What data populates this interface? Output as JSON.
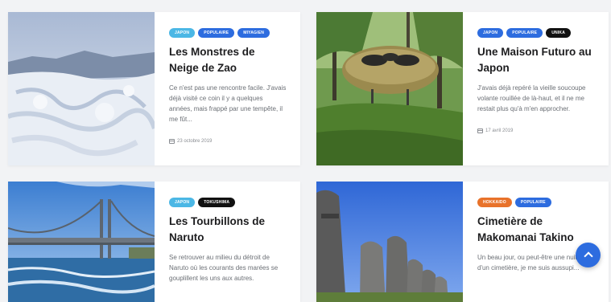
{
  "colors": {
    "tag_cyan": "#4bb7e5",
    "tag_blue": "#2d6cdf",
    "tag_black": "#111111",
    "tag_orange": "#e8722a",
    "fab": "#2d6cdf"
  },
  "posts": [
    {
      "tags": [
        "Japon",
        "Populaire",
        "Miyagien"
      ],
      "title": "Les Monstres de Neige de Zao",
      "excerpt": "Ce n'est pas une rencontre facile. J'avais déjà visité ce coin il y a quelques années, mais frappé par une tempête, il me fût...",
      "date": "23 octobre 2019"
    },
    {
      "tags": [
        "Japon",
        "Populaire",
        "Unika"
      ],
      "title": "Une Maison Futuro au Japon",
      "excerpt": "J'avais déjà repéré la vieille soucoupe volante rouillée de là-haut, et il ne me restait plus qu'à m'en approcher.",
      "date": "17 avril 2019"
    },
    {
      "tags": [
        "Japon",
        "Tokushima"
      ],
      "title": "Les Tourbillons de Naruto",
      "excerpt": "Se retrouver au milieu du détroit de Naruto où les courants des marées se gouplillent les uns aux autres.",
      "date": ""
    },
    {
      "tags": [
        "Hokkaido",
        "Populaire"
      ],
      "title": "Cimetière de Makomanai Takino",
      "excerpt": "Un beau jour, ou peut-être une nuit, près d'un cimetière, je me suis aussupi...",
      "date": ""
    }
  ],
  "scroll_top": {
    "icon": "chevron-up-icon"
  }
}
